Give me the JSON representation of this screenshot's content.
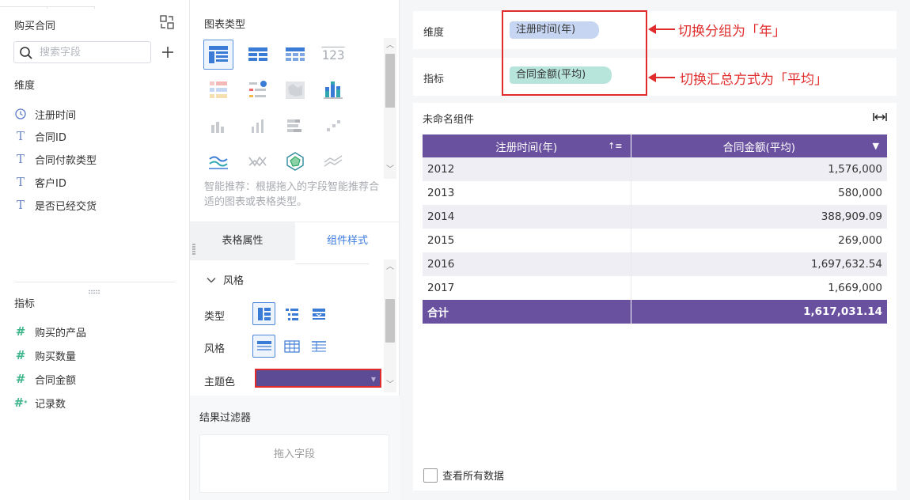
{
  "left_panel": {
    "title": "购买合同",
    "search_placeholder": "搜索字段",
    "dimension_label": "维度",
    "dimensions": [
      "注册时间",
      "合同ID",
      "合同付款类型",
      "客户ID",
      "是否已经交货"
    ],
    "measure_label": "指标",
    "measures": [
      "购买的产品",
      "购买数量",
      "合同金额",
      "记录数"
    ]
  },
  "middle_panel": {
    "chart_type_label": "图表类型",
    "hint": "智能推荐：根据拖入的字段智能推荐合适的图表或表格类型。",
    "tabs": [
      "表格属性",
      "组件样式"
    ],
    "style_section": "风格",
    "type_label": "类型",
    "style_label": "风格",
    "theme_label": "主题色",
    "theme_color": "#5d4c95",
    "filter_title": "结果过滤器",
    "filter_placeholder": "拖入字段"
  },
  "right_panel": {
    "dimension_label": "维度",
    "dimension_pill": "注册时间(年)",
    "measure_label": "指标",
    "measure_pill": "合同金额(平均)",
    "annotation_1": "切换分组为「年」",
    "annotation_2": "切换汇总方式为「平均」",
    "widget_title": "未命名组件",
    "table": {
      "headers": [
        "注册时间(年)",
        "合同金额(平均)"
      ],
      "rows": [
        [
          "2012",
          "1,576,000"
        ],
        [
          "2013",
          "580,000"
        ],
        [
          "2014",
          "388,909.09"
        ],
        [
          "2015",
          "269,000"
        ],
        [
          "2016",
          "1,697,632.54"
        ],
        [
          "2017",
          "1,669,000"
        ]
      ],
      "total": [
        "合计",
        "1,617,031.14"
      ]
    },
    "view_all_label": "查看所有数据"
  },
  "colors": {
    "table_header": "#6a51a0",
    "annotation_red": "#e02c2c",
    "dimension_pill": "#c6d5f2",
    "measure_pill": "#b7e4db",
    "accent_blue": "#3b7be0"
  }
}
